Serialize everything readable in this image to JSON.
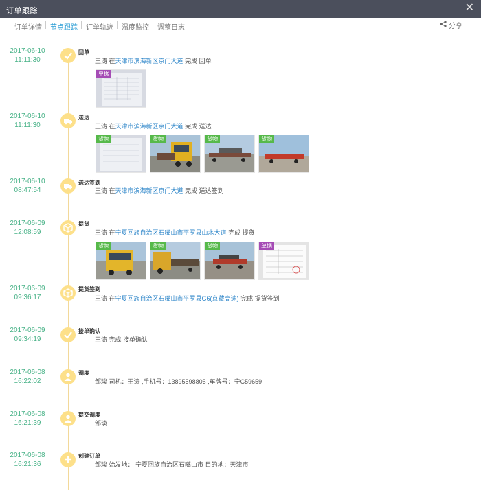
{
  "window": {
    "title": "订单跟踪",
    "close_icon": "close-icon"
  },
  "tabs": [
    {
      "label": "订单详情",
      "active": false
    },
    {
      "label": "节点跟踪",
      "active": true
    },
    {
      "label": "订单轨迹",
      "active": false
    },
    {
      "label": "温度监控",
      "active": false
    },
    {
      "label": "调整日志",
      "active": false
    }
  ],
  "share": {
    "label": "分享",
    "icon": "share-icon"
  },
  "colors": {
    "titlebar": "#4b4f5c",
    "accent": "#3dbcc4",
    "date": "#48b287",
    "node": "#fde08a",
    "location": "#2e86c9",
    "badge_goods": "#56b94a",
    "badge_doc": "#a54cb5"
  },
  "nodes": [
    {
      "date": "2017-06-10",
      "time": "11:11:30",
      "label": "回单",
      "icon": "check-icon",
      "person": "王涛",
      "prefix": "在",
      "location": "天津市滨海新区京门大道",
      "action": "完成 回单",
      "photos": [
        {
          "badge": "单据",
          "kind": "doc"
        }
      ]
    },
    {
      "date": "2017-06-10",
      "time": "11:11:30",
      "label": "送达",
      "icon": "truck-icon",
      "person": "王涛",
      "prefix": "在",
      "location": "天津市滨海新区京门大道",
      "action": "完成 送达",
      "photos": [
        {
          "badge": "货物",
          "kind": "doc"
        },
        {
          "badge": "货物",
          "kind": "truck"
        },
        {
          "badge": "货物",
          "kind": "truck"
        },
        {
          "badge": "货物",
          "kind": "truck"
        }
      ]
    },
    {
      "date": "2017-06-10",
      "time": "08:47:54",
      "label": "送达签到",
      "icon": "truck-icon",
      "person": "王涛",
      "prefix": "在",
      "location": "天津市滨海新区京门大道",
      "action": "完成 送达签到",
      "photos": []
    },
    {
      "date": "2017-06-09",
      "time": "12:08:59",
      "label": "提货",
      "icon": "box-icon",
      "person": "王涛",
      "prefix": "在",
      "location": "宁夏回族自治区石嘴山市平罗县山水大道",
      "action": "完成 提货",
      "photos": [
        {
          "badge": "货物",
          "kind": "truck"
        },
        {
          "badge": "货物",
          "kind": "truck"
        },
        {
          "badge": "货物",
          "kind": "truck"
        },
        {
          "badge": "单据",
          "kind": "doc"
        }
      ]
    },
    {
      "date": "2017-06-09",
      "time": "09:36:17",
      "label": "提货签到",
      "icon": "box-icon",
      "person": "王涛",
      "prefix": "在",
      "location": "宁夏回族自治区石嘴山市平罗县G6(京藏高速)",
      "action": "完成 提货签到",
      "photos": []
    },
    {
      "date": "2017-06-09",
      "time": "09:34:19",
      "label": "接单确认",
      "icon": "check-icon",
      "person": "王涛",
      "prefix": "",
      "location": "",
      "action": "完成 接单确认",
      "photos": []
    },
    {
      "date": "2017-06-08",
      "time": "16:22:02",
      "label": "调度",
      "icon": "dispatcher-icon",
      "person": "邹琰",
      "prefix": "",
      "location": "",
      "action": "司机：王涛 ,手机号：13895598805 ,车牌号：宁C59659",
      "photos": []
    },
    {
      "date": "2017-06-08",
      "time": "16:21:39",
      "label": "提交调度",
      "icon": "dispatcher-icon",
      "person": "邹琰",
      "prefix": "",
      "location": "",
      "action": "",
      "photos": []
    },
    {
      "date": "2017-06-08",
      "time": "16:21:36",
      "label": "创建订单",
      "icon": "plus-icon",
      "person": "邹琰",
      "prefix": "",
      "location": "",
      "action": "始发地： 宁夏回族自治区石嘴山市 目的地：天津市",
      "photos": []
    }
  ]
}
